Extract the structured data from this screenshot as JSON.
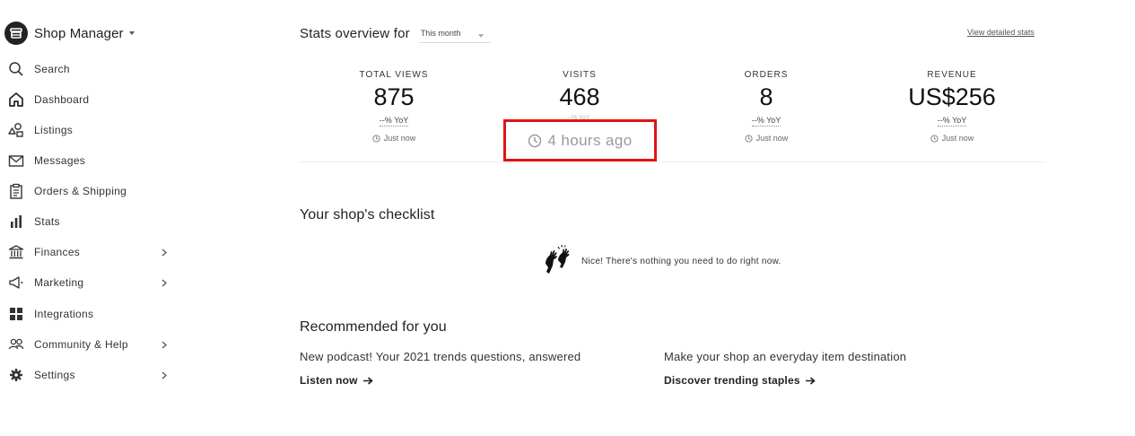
{
  "sidebar": {
    "title": "Shop Manager",
    "items": [
      {
        "label": "Search",
        "icon": "search-icon"
      },
      {
        "label": "Dashboard",
        "icon": "home-icon"
      },
      {
        "label": "Listings",
        "icon": "shapes-icon"
      },
      {
        "label": "Messages",
        "icon": "envelope-icon"
      },
      {
        "label": "Orders & Shipping",
        "icon": "clipboard-icon"
      },
      {
        "label": "Stats",
        "icon": "bar-chart-icon"
      },
      {
        "label": "Finances",
        "icon": "bank-icon"
      },
      {
        "label": "Marketing",
        "icon": "megaphone-icon"
      },
      {
        "label": "Integrations",
        "icon": "grid-icon"
      },
      {
        "label": "Community & Help",
        "icon": "people-icon"
      },
      {
        "label": "Settings",
        "icon": "gear-icon"
      }
    ]
  },
  "stats": {
    "title": "Stats overview for",
    "period": "This month",
    "detailed_link": "View detailed stats",
    "cards": [
      {
        "label": "TOTAL VIEWS",
        "value": "875",
        "yoy": "--% YoY",
        "updated": "Just now"
      },
      {
        "label": "VISITS",
        "value": "468",
        "yoy": "--% YoY",
        "updated": "4 hours ago"
      },
      {
        "label": "ORDERS",
        "value": "8",
        "yoy": "--% YoY",
        "updated": "Just now"
      },
      {
        "label": "REVENUE",
        "value": "US$256",
        "yoy": "--% YoY",
        "updated": "Just now"
      }
    ]
  },
  "checklist": {
    "title": "Your shop's checklist",
    "message": "Nice! There's nothing you need to do right now."
  },
  "recommended": {
    "title": "Recommended for you",
    "cards": [
      {
        "desc": "New podcast! Your 2021 trends questions, answered",
        "link": "Listen now"
      },
      {
        "desc": "Make your shop an everyday item destination",
        "link": "Discover trending staples"
      }
    ]
  },
  "colors": {
    "highlight_border": "#e01414",
    "text": "#222222"
  }
}
